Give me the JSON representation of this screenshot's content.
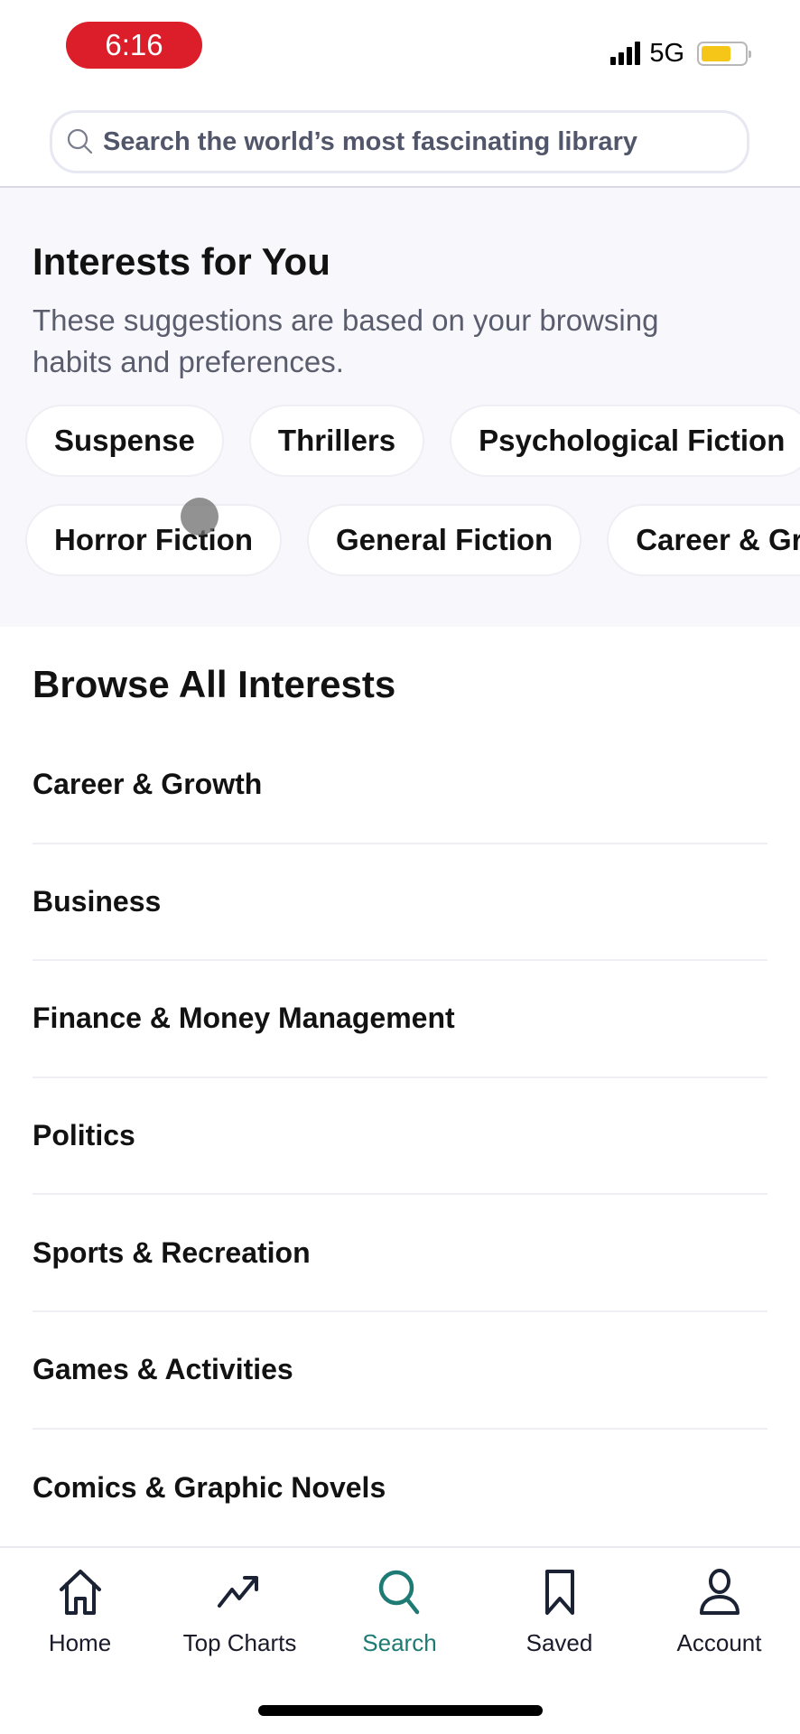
{
  "status_bar": {
    "time": "6:16",
    "network": "5G",
    "signal_bars": 4,
    "battery_level": 0.7,
    "colors": {
      "time_pill": "#dc1e2a",
      "battery": "#f5c518"
    }
  },
  "search": {
    "placeholder": "Search the world’s most fascinating library",
    "value": "",
    "icon": "search-icon"
  },
  "interests_for_you": {
    "title": "Interests for You",
    "subtitle": "These suggestions are based on your browsing habits and preferences.",
    "chips_row1": [
      "Suspense",
      "Thrillers",
      "Psychological Fiction"
    ],
    "chips_row2": [
      "Horror Fiction",
      "General Fiction",
      "Career & Growth"
    ]
  },
  "browse_all": {
    "title": "Browse All Interests",
    "items": [
      "Career & Growth",
      "Business",
      "Finance & Money Management",
      "Politics",
      "Sports & Recreation",
      "Games & Activities",
      "Comics & Graphic Novels"
    ]
  },
  "bottom_nav": {
    "active_color": "#1e7b74",
    "items": [
      {
        "label": "Home",
        "icon": "home-icon",
        "active": false
      },
      {
        "label": "Top Charts",
        "icon": "trending-up-icon",
        "active": false
      },
      {
        "label": "Search",
        "icon": "search-icon",
        "active": true
      },
      {
        "label": "Saved",
        "icon": "bookmark-icon",
        "active": false
      },
      {
        "label": "Account",
        "icon": "user-icon",
        "active": false
      }
    ]
  }
}
